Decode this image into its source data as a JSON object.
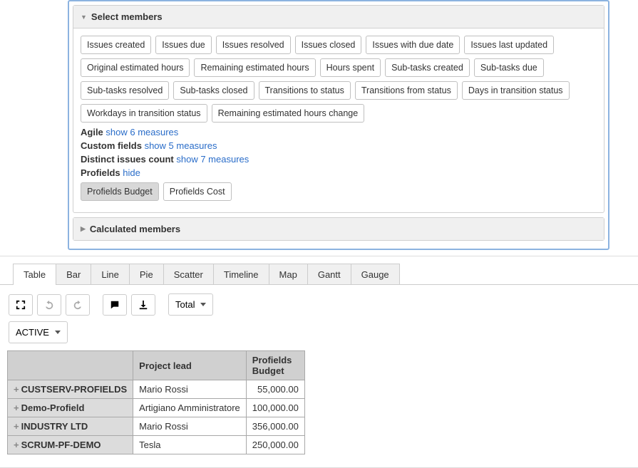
{
  "panels": {
    "select_members_title": "Select members",
    "calculated_members_title": "Calculated members"
  },
  "member_tags": [
    "Issues created",
    "Issues due",
    "Issues resolved",
    "Issues closed",
    "Issues with due date",
    "Issues last updated",
    "Original estimated hours",
    "Remaining estimated hours",
    "Hours spent",
    "Sub-tasks created",
    "Sub-tasks due",
    "Sub-tasks resolved",
    "Sub-tasks closed",
    "Transitions to status",
    "Transitions from status",
    "Days in transition status",
    "Workdays in transition status",
    "Remaining estimated hours change"
  ],
  "measure_groups": [
    {
      "name": "Agile",
      "link": "show 6 measures"
    },
    {
      "name": "Custom fields",
      "link": "show 5 measures"
    },
    {
      "name": "Distinct issues count",
      "link": "show 7 measures"
    },
    {
      "name": "Profields",
      "link": "hide"
    }
  ],
  "profields_tags": {
    "budget": "Profields Budget",
    "cost": "Profields Cost"
  },
  "view_tabs": [
    "Table",
    "Bar",
    "Line",
    "Pie",
    "Scatter",
    "Timeline",
    "Map",
    "Gantt",
    "Gauge"
  ],
  "toolbar": {
    "total": "Total",
    "active_filter": "ACTIVE"
  },
  "table": {
    "col_project_lead": "Project lead",
    "col_profields_budget": "Profields Budget",
    "rows": [
      {
        "name": "CUSTSERV-PROFIELDS",
        "lead": "Mario Rossi",
        "budget": "55,000.00"
      },
      {
        "name": "Demo-Profield",
        "lead": "Artigiano Amministratore",
        "budget": "100,000.00"
      },
      {
        "name": "INDUSTRY LTD",
        "lead": "Mario Rossi",
        "budget": "356,000.00"
      },
      {
        "name": "SCRUM-PF-DEMO",
        "lead": "Tesla",
        "budget": "250,000.00"
      }
    ]
  }
}
